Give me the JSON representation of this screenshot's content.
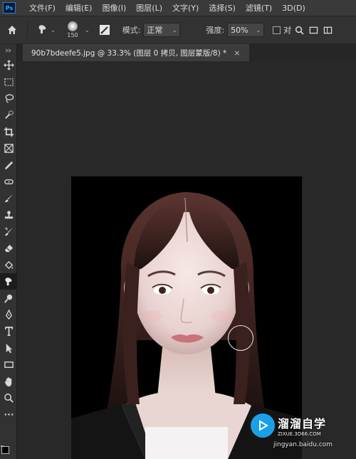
{
  "menubar": {
    "logo": "Ps",
    "items": [
      "文件(F)",
      "编辑(E)",
      "图像(I)",
      "图层(L)",
      "文字(Y)",
      "选择(S)",
      "滤镜(T)",
      "3D(D)"
    ]
  },
  "options": {
    "brush_size": "150",
    "mode_label": "模式:",
    "mode_value": "正常",
    "strength_label": "强度:",
    "strength_value": "50%",
    "sample_all_label": "对",
    "icons": [
      "home-icon",
      "smudge-icon",
      "brush-settings-icon",
      "search-icon",
      "frame-icon",
      "panels-icon"
    ]
  },
  "document": {
    "tab_title": "90b7bdeefe5.jpg @ 33.3% (图层 0 拷贝, 图层蒙版/8) *",
    "close": "×"
  },
  "tools": [
    "move-icon",
    "marquee-icon",
    "lasso-icon",
    "quick-select-icon",
    "crop-icon",
    "frame-icon",
    "eyedropper-icon",
    "healing-icon",
    "brush-icon",
    "stamp-icon",
    "history-brush-icon",
    "eraser-icon",
    "bucket-icon",
    "smudge-icon",
    "dodge-icon",
    "pen-icon",
    "type-icon",
    "path-select-icon",
    "rectangle-icon",
    "hand-icon",
    "zoom-icon",
    "more-icon"
  ],
  "active_tool": "smudge-icon",
  "watermark": {
    "name": "溜溜自学",
    "url": "ZIXUE.3D66.COM",
    "baidu": "jingyan.baidu.com"
  },
  "colors": {
    "menubar": "#3a3a3a",
    "panel": "#323232",
    "workspace": "#282828",
    "photo_bg": "#000000",
    "watermark_blue": "#1aa0e6"
  }
}
